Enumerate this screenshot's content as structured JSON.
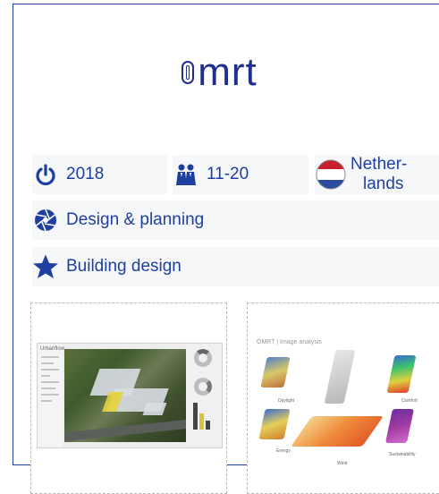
{
  "brand": {
    "logo_text": "mrt",
    "logo_glyph": "o"
  },
  "facts": {
    "year": {
      "icon": "power-icon",
      "value": "2018"
    },
    "team_size": {
      "icon": "people-icon",
      "value": "11-20"
    },
    "country": {
      "icon": "netherlands-flag-icon",
      "value_line1": "Nether-",
      "value_line2": "lands"
    }
  },
  "category": {
    "icon": "aperture-icon",
    "label": "Design & planning"
  },
  "service": {
    "icon": "star-icon",
    "label": "Building design"
  },
  "gallery": {
    "thumb1": {
      "app_title": "Urbanflow"
    },
    "thumb2": {
      "title": "OMRT | Image analysis",
      "labels": [
        "Daylight",
        "",
        "Comfort",
        "Energy",
        "Wind",
        "Sustainability"
      ]
    }
  },
  "colors": {
    "accent": "#1f3fa0",
    "tile_bg": "#f6f7f9",
    "border": "#1f3fa0"
  }
}
